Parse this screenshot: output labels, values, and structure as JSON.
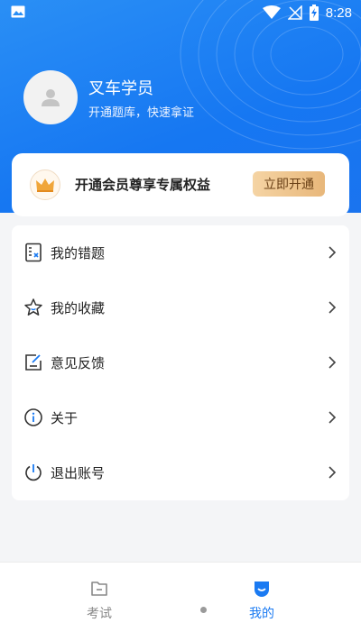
{
  "status_bar": {
    "time": "8:28",
    "icons": [
      "image-icon",
      "wifi-icon",
      "no-signal-icon",
      "battery-charging-icon"
    ]
  },
  "profile": {
    "name": "叉车学员",
    "subtitle": "开通题库，快速拿证"
  },
  "vip": {
    "text": "开通会员尊享专属权益",
    "button": "立即开通",
    "icon": "crown-icon"
  },
  "menu": {
    "items": [
      {
        "label": "我的错题",
        "icon": "wrong-questions-icon"
      },
      {
        "label": "我的收藏",
        "icon": "star-icon"
      },
      {
        "label": "意见反馈",
        "icon": "feedback-icon"
      },
      {
        "label": "关于",
        "icon": "info-icon"
      },
      {
        "label": "退出账号",
        "icon": "power-icon"
      }
    ]
  },
  "tabbar": {
    "tabs": [
      {
        "label": "考试",
        "icon": "folder-icon",
        "active": false
      },
      {
        "label": "我的",
        "icon": "smile-icon",
        "active": true
      }
    ]
  },
  "colors": {
    "primary": "#1a7af2",
    "header_bg": "#1677f2",
    "vip_button_start": "#f5d4a4",
    "vip_button_end": "#e8b77a",
    "page_bg": "#f4f5f7"
  }
}
